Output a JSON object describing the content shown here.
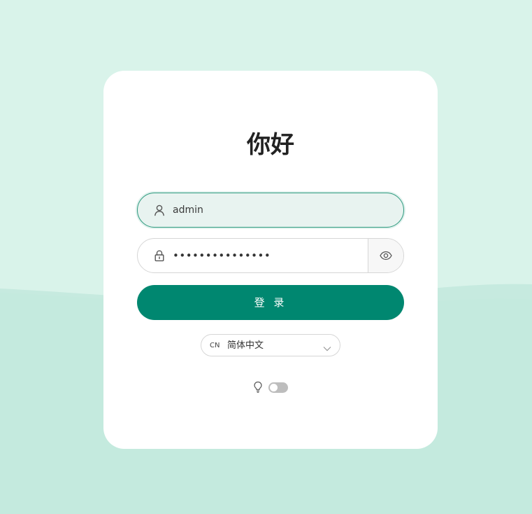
{
  "login": {
    "title": "你好",
    "username_value": "admin",
    "password_masked": "•••••••••••••••",
    "submit_label": "登 录"
  },
  "language": {
    "code": "CN",
    "selected": "简体中文"
  },
  "theme": {
    "dark_mode_enabled": false
  },
  "icons": {
    "username": "user-icon",
    "password": "lock-icon",
    "show_password": "eye-icon",
    "dropdown": "chevron-down-icon",
    "theme": "lightbulb-icon"
  },
  "colors": {
    "background": "#d9f3ea",
    "wave": "#c6eadf",
    "primary": "#008770",
    "focus_border": "#2e9a7e",
    "card": "#ffffff"
  }
}
